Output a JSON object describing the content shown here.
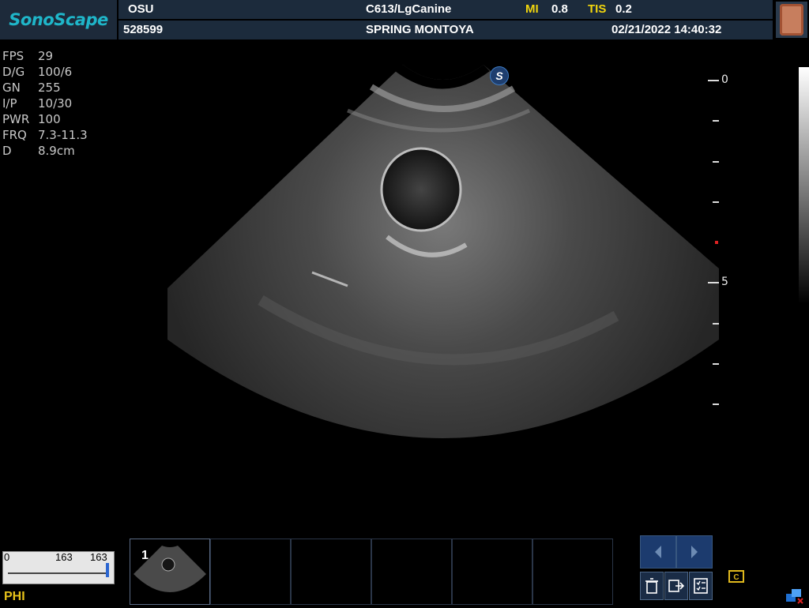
{
  "header": {
    "logo": "SonoScape",
    "institution": "OSU",
    "probe_preset": "C613/LgCanine",
    "mi_label": "MI",
    "mi_value": "0.8",
    "tis_label": "TIS",
    "tis_value": "0.2",
    "patient_id": "528599",
    "patient_name": "SPRING MONTOYA",
    "datetime": "02/21/2022 14:40:32"
  },
  "params": [
    {
      "label": "FPS",
      "value": "29"
    },
    {
      "label": "D/G",
      "value": "100/6"
    },
    {
      "label": "GN",
      "value": "255"
    },
    {
      "label": "I/P",
      "value": "10/30"
    },
    {
      "label": "PWR",
      "value": "100"
    },
    {
      "label": "FRQ",
      "value": "7.3-11.3"
    },
    {
      "label": "D",
      "value": "8.9cm"
    }
  ],
  "probe_badge": "S",
  "depth_scale": {
    "label_top": "0",
    "label_mid": "5"
  },
  "cine": {
    "start": "0",
    "current": "163",
    "total": "163",
    "mode": "PHI"
  },
  "thumbnails": [
    {
      "number": "1"
    }
  ],
  "colors": {
    "header_bg": "#1c2b3c",
    "logo_text": "#1fb6c9",
    "accent_yellow": "#f2d60d",
    "nav_button": "#1c3b6e"
  },
  "icons": {
    "prev": "chevron-left-icon",
    "next": "chevron-right-icon",
    "delete": "trash-icon",
    "export": "export-icon",
    "checklist": "checklist-icon",
    "film": "film-icon",
    "network": "network-icon"
  }
}
